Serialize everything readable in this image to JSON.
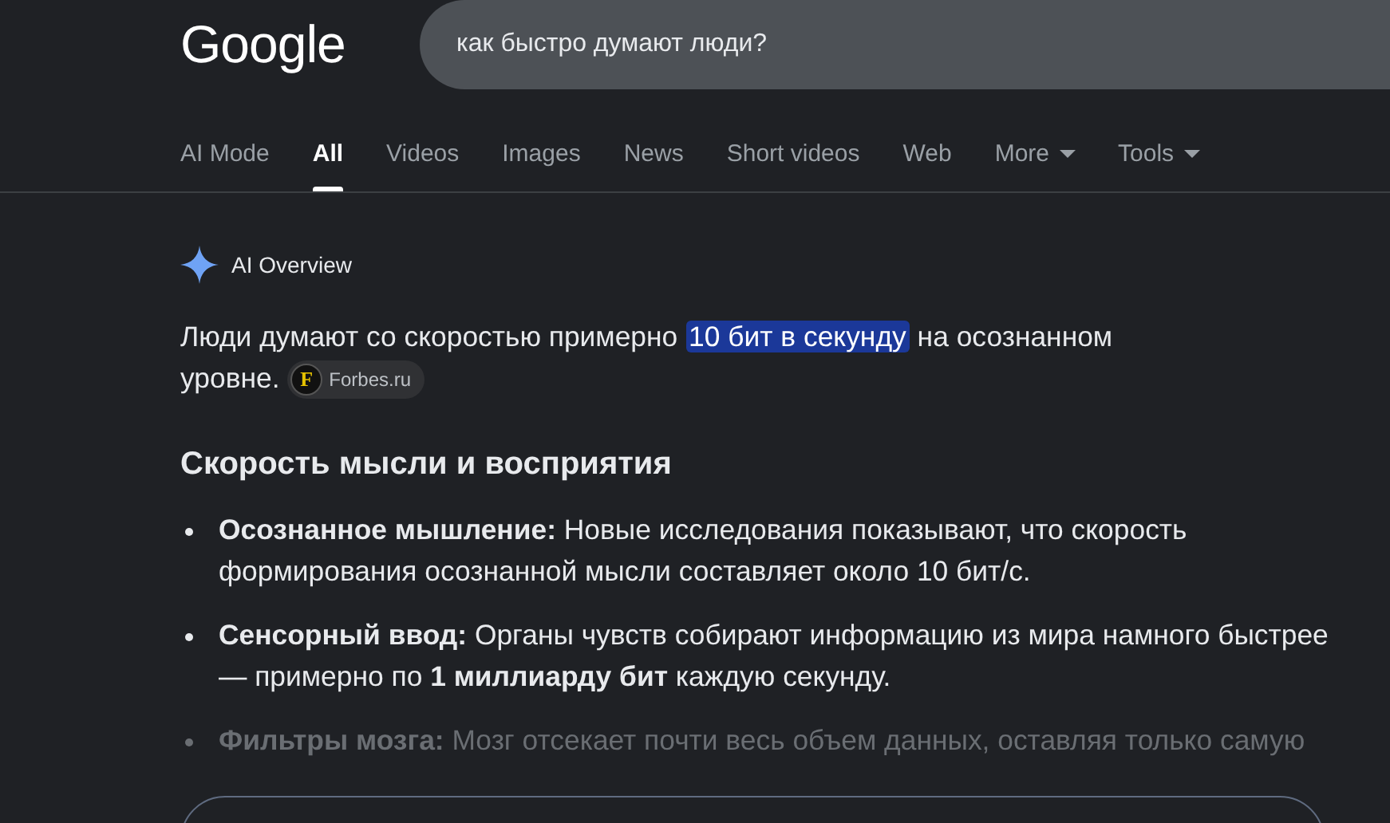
{
  "header": {
    "logo": "Google",
    "search": {
      "value": "как быстро думают люди?"
    }
  },
  "tabs": [
    {
      "label": "AI Mode",
      "selected": false,
      "has_menu": false
    },
    {
      "label": "All",
      "selected": true,
      "has_menu": false
    },
    {
      "label": "Videos",
      "selected": false,
      "has_menu": false
    },
    {
      "label": "Images",
      "selected": false,
      "has_menu": false
    },
    {
      "label": "News",
      "selected": false,
      "has_menu": false
    },
    {
      "label": "Short videos",
      "selected": false,
      "has_menu": false
    },
    {
      "label": "Web",
      "selected": false,
      "has_menu": false
    },
    {
      "label": "More",
      "selected": false,
      "has_menu": true
    },
    {
      "label": "Tools",
      "selected": false,
      "has_menu": true
    }
  ],
  "overview": {
    "title": "AI Overview",
    "summary_before": "Люди думают со скоростью примерно",
    "summary_highlight": "10 бит в секунду",
    "summary_after": [
      "на осознанном",
      "уровне."
    ],
    "source": {
      "letter": "F",
      "name": "Forbes.ru"
    },
    "heading": "Скорость мысли и восприятия",
    "bullets": [
      {
        "text": "**Осознанное мышление:** Новые исследования показывают, что скорость формирования осознанной мысли составляет около 10 бит/с.",
        "faded": false
      },
      {
        "text": "**Сенсорный ввод:** Органы чувств собирают информацию из мира намного быстрее — примерно по **1 миллиарду бит** каждую секунду.",
        "faded": false
      },
      {
        "text": "**Фильтры мозга:** Мозг отсекает почти весь объем данных, оставляя только самую",
        "faded": true
      }
    ]
  }
}
